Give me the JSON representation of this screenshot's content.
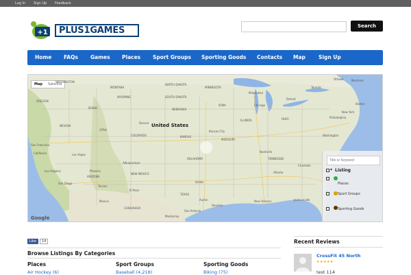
{
  "topbar": {
    "login": "Log In",
    "signup": "Sign Up",
    "feedback": "Feedback"
  },
  "logo": {
    "badge": "+1",
    "text": "PLUS1GAMES"
  },
  "search": {
    "placeholder": "",
    "button": "Search"
  },
  "nav": [
    "Home",
    "FAQs",
    "Games",
    "Places",
    "Sport Groups",
    "Sporting Goods",
    "Contacts",
    "Map",
    "Sign Up"
  ],
  "map": {
    "type_map": "Map",
    "type_satellite": "Satellite",
    "country": "United States",
    "google": "Google",
    "labels": [
      "WASHINGTON",
      "MONTANA",
      "NORTH DAKOTA",
      "MINNESOTA",
      "SOUTH DAKOTA",
      "WYOMING",
      "OREGON",
      "IDAHO",
      "NEBRASKA",
      "IOWA",
      "Chicago",
      "Milwaukee",
      "Detroit",
      "Toronto",
      "Ottawa",
      "Montreal",
      "Boston",
      "New York",
      "Philadelphia",
      "Washington",
      "Denver",
      "KANSAS",
      "MISSOURI",
      "Kansas City",
      "ILLINOIS",
      "OHIO",
      "NEVADA",
      "UTAH",
      "COLORADO",
      "San Francisco",
      "California",
      "Las Vegas",
      "Los Angeles",
      "San Diego",
      "ARIZONA",
      "Phoenix",
      "NEW MEXICO",
      "Albuquerque",
      "OKLAHOMA",
      "Tucson",
      "El Paso",
      "Dallas",
      "TEXAS",
      "Houston",
      "San Antonio",
      "Austin",
      "TENNESSEE",
      "Nashville",
      "Atlanta",
      "Charlotte",
      "New Orleans",
      "Jacksonville",
      "CHIHUAHUA",
      "Monterrey",
      "Mexico"
    ]
  },
  "panel": {
    "placeholder": "Title or Keyword",
    "title": "Listing",
    "items": [
      "Places",
      "Sport Groups",
      "Sporting Goods"
    ],
    "colors": [
      "#2fae3a",
      "#e0a000",
      "#5a3a00"
    ]
  },
  "social": {
    "like": "Like",
    "count": "14"
  },
  "browse": {
    "title": "Browse Listings By Categories",
    "categories": [
      {
        "title": "Places",
        "first": "Air Hockey (6)"
      },
      {
        "title": "Sport Groups",
        "first": "Baseball (4,218)"
      },
      {
        "title": "Sporting Goods",
        "first": "Biking (75)"
      }
    ]
  },
  "reviews": {
    "title": "Recent Reviews",
    "name": "CrossFit 45 North",
    "stars": "★★★★★",
    "text": "test 114"
  },
  "colors": {
    "nav": "#1a67c9",
    "topbar": "#5f5f5f",
    "link": "#1a67c9",
    "star": "#f0a400"
  }
}
